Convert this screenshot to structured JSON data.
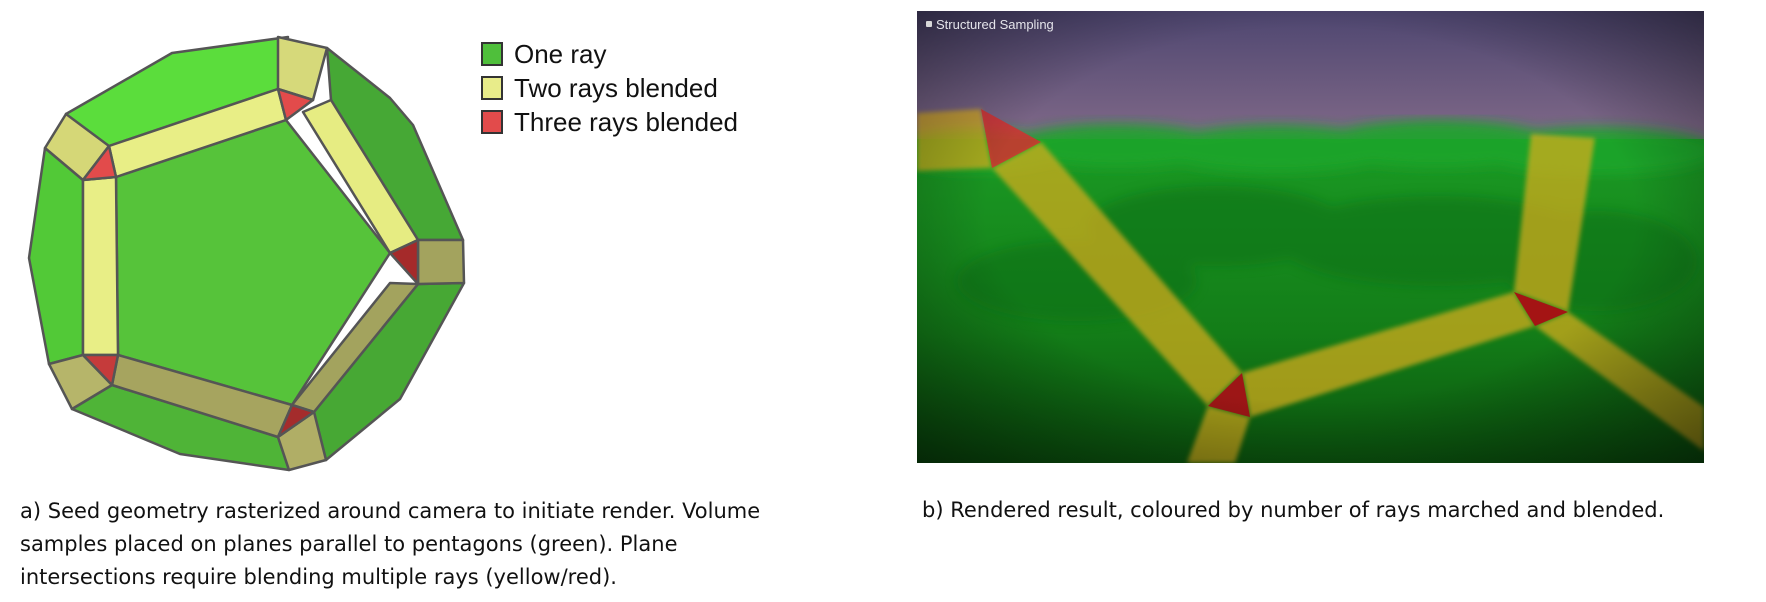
{
  "legend": {
    "items": [
      {
        "label": "One ray",
        "color": "#4fbf3b"
      },
      {
        "label": "Two rays blended",
        "color": "#e8ec8a"
      },
      {
        "label": "Three rays blended",
        "color": "#e24b4b"
      }
    ]
  },
  "render": {
    "title": "Structured Sampling"
  },
  "captions": {
    "a_line1": "a) Seed geometry rasterized around camera to initiate render. Volume",
    "a_line2": "samples placed on planes parallel to pentagons (green). Plane",
    "a_line3": "intersections require blending multiple rays (yellow/red).",
    "b": "b) Rendered result, coloured by number of rays marched and blended."
  },
  "colors": {
    "green_light": "#5bdd3c",
    "green_mid": "#4cbb34",
    "green_dark": "#3f9e2d",
    "yellow_lit": "#e8ee86",
    "yellow_shade": "#a7a660",
    "red": "#e24b4b",
    "red_dark": "#a52a2a"
  }
}
